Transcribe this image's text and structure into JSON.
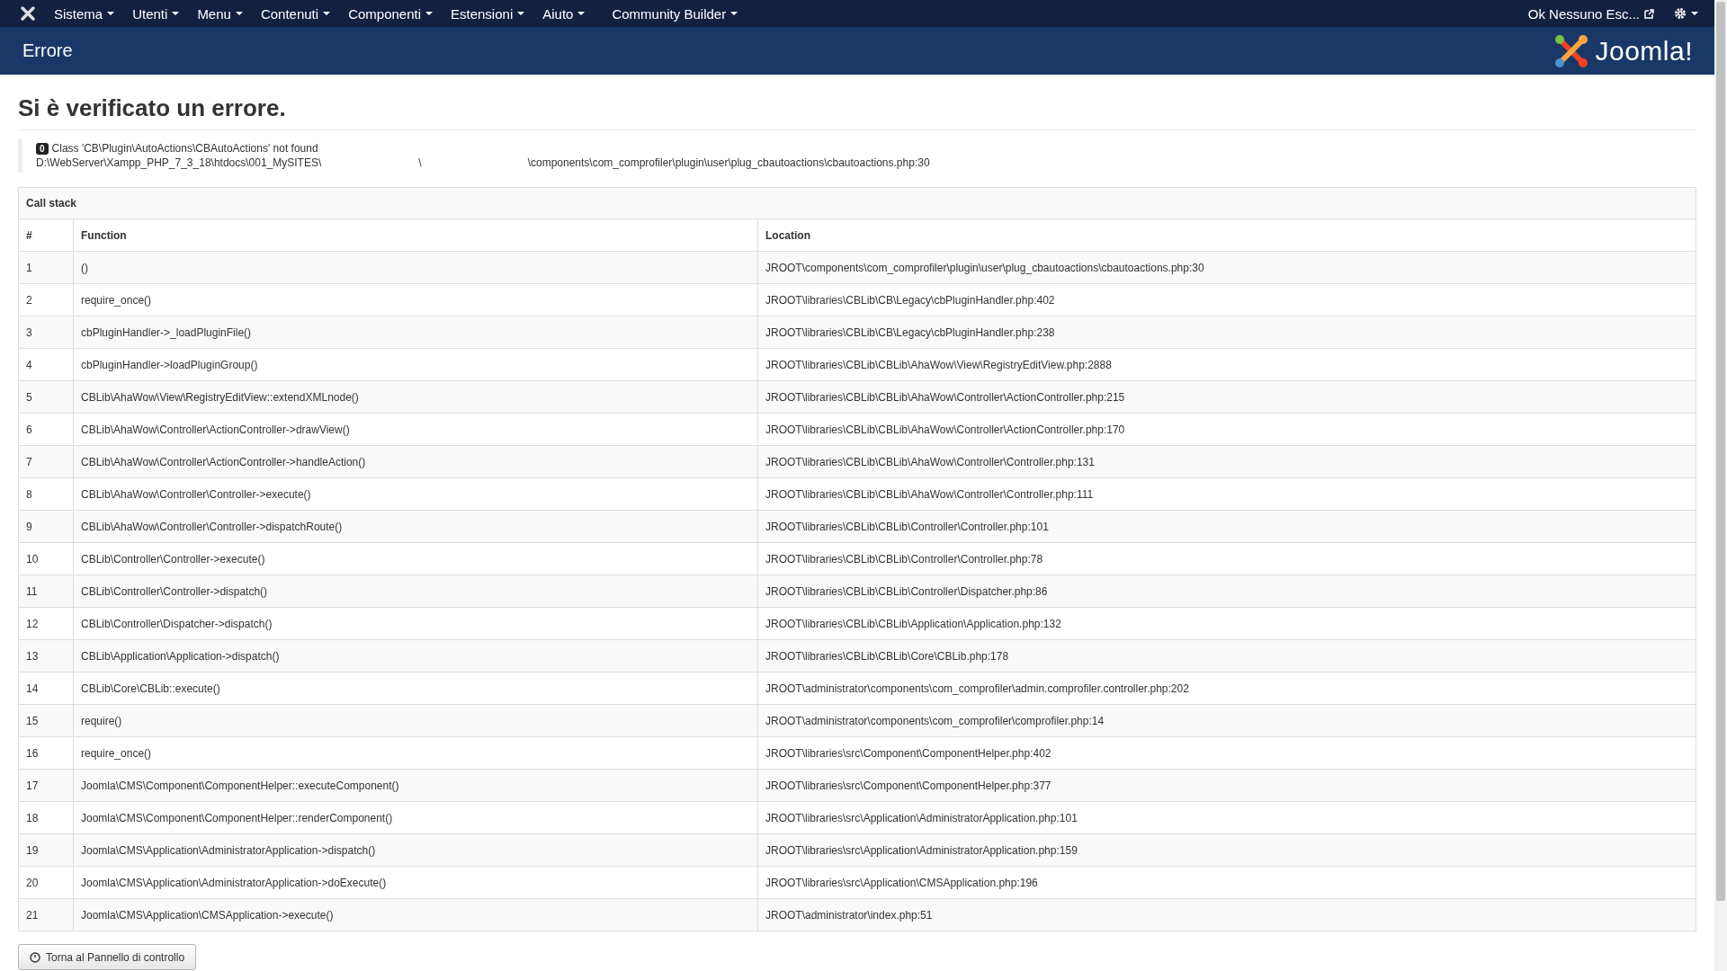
{
  "navbar": {
    "menus": [
      "Sistema",
      "Utenti",
      "Menu",
      "Contenuti",
      "Componenti",
      "Estensioni",
      "Aiuto",
      "Community Builder"
    ],
    "user_link": "Ok Nessuno Esc..."
  },
  "header": {
    "title": "Errore",
    "logo_text": "Joomla!"
  },
  "error": {
    "heading": "Si è verificato un errore.",
    "code": "0",
    "message": "Class 'CB\\Plugin\\AutoActions\\CBAutoActions' not found",
    "path_parts": [
      "D:\\WebServer\\Xampp_PHP_7_3_18\\htdocs\\001_MySITES\\",
      "\\",
      "\\components\\com_comprofiler\\plugin\\user\\plug_cbautoactions\\cbautoactions.php:30"
    ]
  },
  "call_stack": {
    "title": "Call stack",
    "columns": [
      "#",
      "Function",
      "Location"
    ],
    "rows": [
      [
        "1",
        "()",
        "JROOT\\components\\com_comprofiler\\plugin\\user\\plug_cbautoactions\\cbautoactions.php:30"
      ],
      [
        "2",
        "require_once()",
        "JROOT\\libraries\\CBLib\\CB\\Legacy\\cbPluginHandler.php:402"
      ],
      [
        "3",
        "cbPluginHandler->_loadPluginFile()",
        "JROOT\\libraries\\CBLib\\CB\\Legacy\\cbPluginHandler.php:238"
      ],
      [
        "4",
        "cbPluginHandler->loadPluginGroup()",
        "JROOT\\libraries\\CBLib\\CBLib\\AhaWow\\View\\RegistryEditView.php:2888"
      ],
      [
        "5",
        "CBLib\\AhaWow\\View\\RegistryEditView::extendXMLnode()",
        "JROOT\\libraries\\CBLib\\CBLib\\AhaWow\\Controller\\ActionController.php:215"
      ],
      [
        "6",
        "CBLib\\AhaWow\\Controller\\ActionController->drawView()",
        "JROOT\\libraries\\CBLib\\CBLib\\AhaWow\\Controller\\ActionController.php:170"
      ],
      [
        "7",
        "CBLib\\AhaWow\\Controller\\ActionController->handleAction()",
        "JROOT\\libraries\\CBLib\\CBLib\\AhaWow\\Controller\\Controller.php:131"
      ],
      [
        "8",
        "CBLib\\AhaWow\\Controller\\Controller->execute()",
        "JROOT\\libraries\\CBLib\\CBLib\\AhaWow\\Controller\\Controller.php:111"
      ],
      [
        "9",
        "CBLib\\AhaWow\\Controller\\Controller->dispatchRoute()",
        "JROOT\\libraries\\CBLib\\CBLib\\Controller\\Controller.php:101"
      ],
      [
        "10",
        "CBLib\\Controller\\Controller->execute()",
        "JROOT\\libraries\\CBLib\\CBLib\\Controller\\Controller.php:78"
      ],
      [
        "11",
        "CBLib\\Controller\\Controller->dispatch()",
        "JROOT\\libraries\\CBLib\\CBLib\\Controller\\Dispatcher.php:86"
      ],
      [
        "12",
        "CBLib\\Controller\\Dispatcher->dispatch()",
        "JROOT\\libraries\\CBLib\\CBLib\\Application\\Application.php:132"
      ],
      [
        "13",
        "CBLib\\Application\\Application->dispatch()",
        "JROOT\\libraries\\CBLib\\CBLib\\Core\\CBLib.php:178"
      ],
      [
        "14",
        "CBLib\\Core\\CBLib::execute()",
        "JROOT\\administrator\\components\\com_comprofiler\\admin.comprofiler.controller.php:202"
      ],
      [
        "15",
        "require()",
        "JROOT\\administrator\\components\\com_comprofiler\\comprofiler.php:14"
      ],
      [
        "16",
        "require_once()",
        "JROOT\\libraries\\src\\Component\\ComponentHelper.php:402"
      ],
      [
        "17",
        "Joomla\\CMS\\Component\\ComponentHelper::executeComponent()",
        "JROOT\\libraries\\src\\Component\\ComponentHelper.php:377"
      ],
      [
        "18",
        "Joomla\\CMS\\Component\\ComponentHelper::renderComponent()",
        "JROOT\\libraries\\src\\Application\\AdministratorApplication.php:101"
      ],
      [
        "19",
        "Joomla\\CMS\\Application\\AdministratorApplication->dispatch()",
        "JROOT\\libraries\\src\\Application\\AdministratorApplication.php:159"
      ],
      [
        "20",
        "Joomla\\CMS\\Application\\AdministratorApplication->doExecute()",
        "JROOT\\libraries\\src\\Application\\CMSApplication.php:196"
      ],
      [
        "21",
        "Joomla\\CMS\\Application\\CMSApplication->execute()",
        "JROOT\\administrator\\index.php:51"
      ]
    ]
  },
  "back_button": "Torna al Pannello di controllo"
}
